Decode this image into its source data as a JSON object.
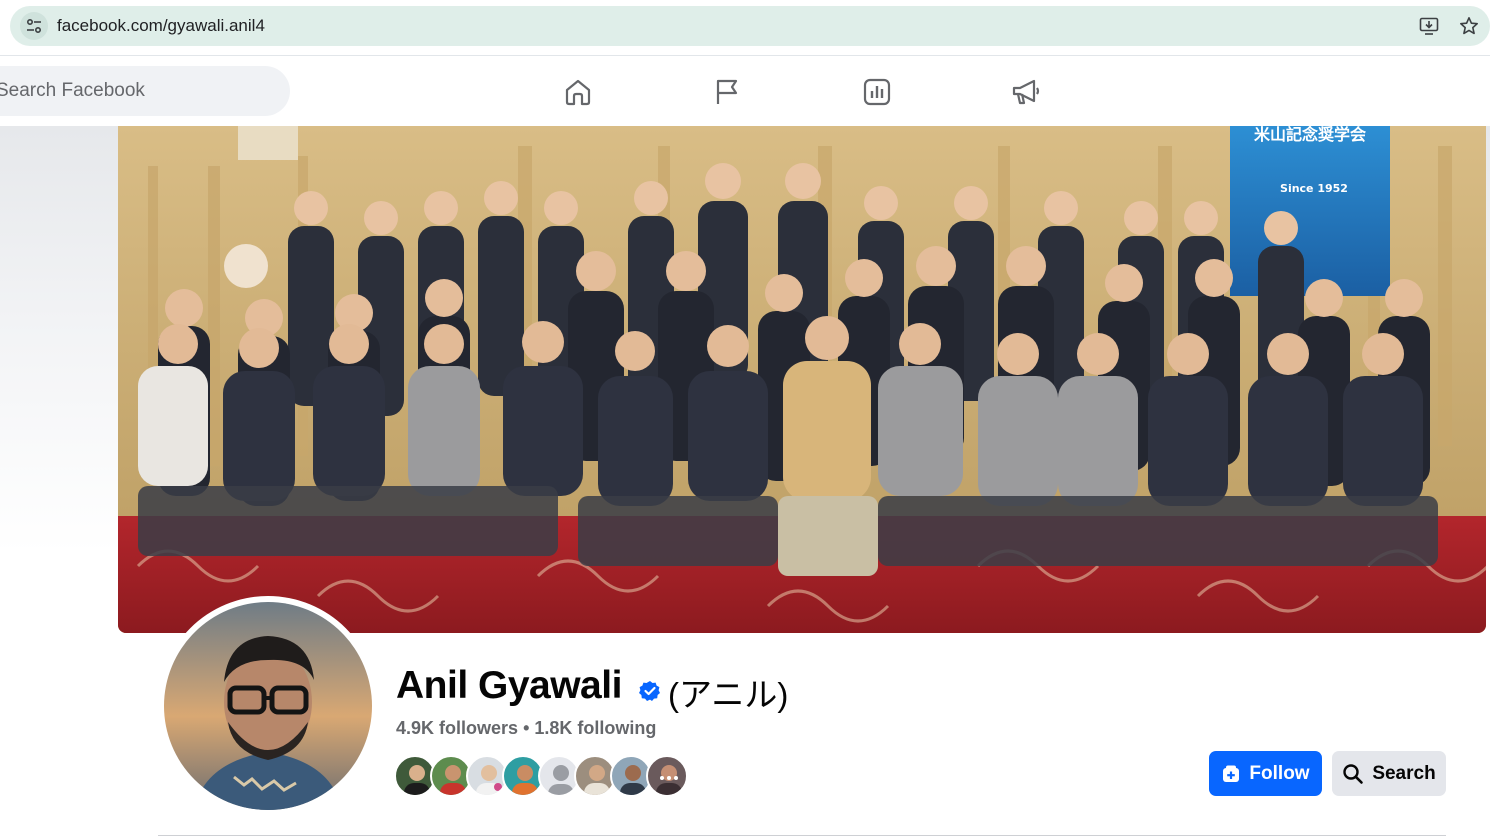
{
  "browser": {
    "url": "facebook.com/gyawali.anil4",
    "icons": [
      "site-info-icon",
      "install-app-icon",
      "bookmark-star-icon"
    ]
  },
  "header": {
    "search_placeholder": "Search Facebook",
    "nav_icons": [
      "home-icon",
      "flag-icon",
      "insights-icon",
      "megaphone-icon"
    ],
    "brand_color": "#0866ff"
  },
  "cover": {
    "banner_text": "米山記念奨学会",
    "banner_year": "Since 1952"
  },
  "profile": {
    "name": "Anil Gyawali",
    "alt_name": "(アニル)",
    "verified": true,
    "followers": "4.9K followers",
    "separator": "•",
    "following": "1.8K following",
    "mutual_friend_count": 8
  },
  "actions": {
    "follow_label": "Follow",
    "search_label": "Search"
  }
}
